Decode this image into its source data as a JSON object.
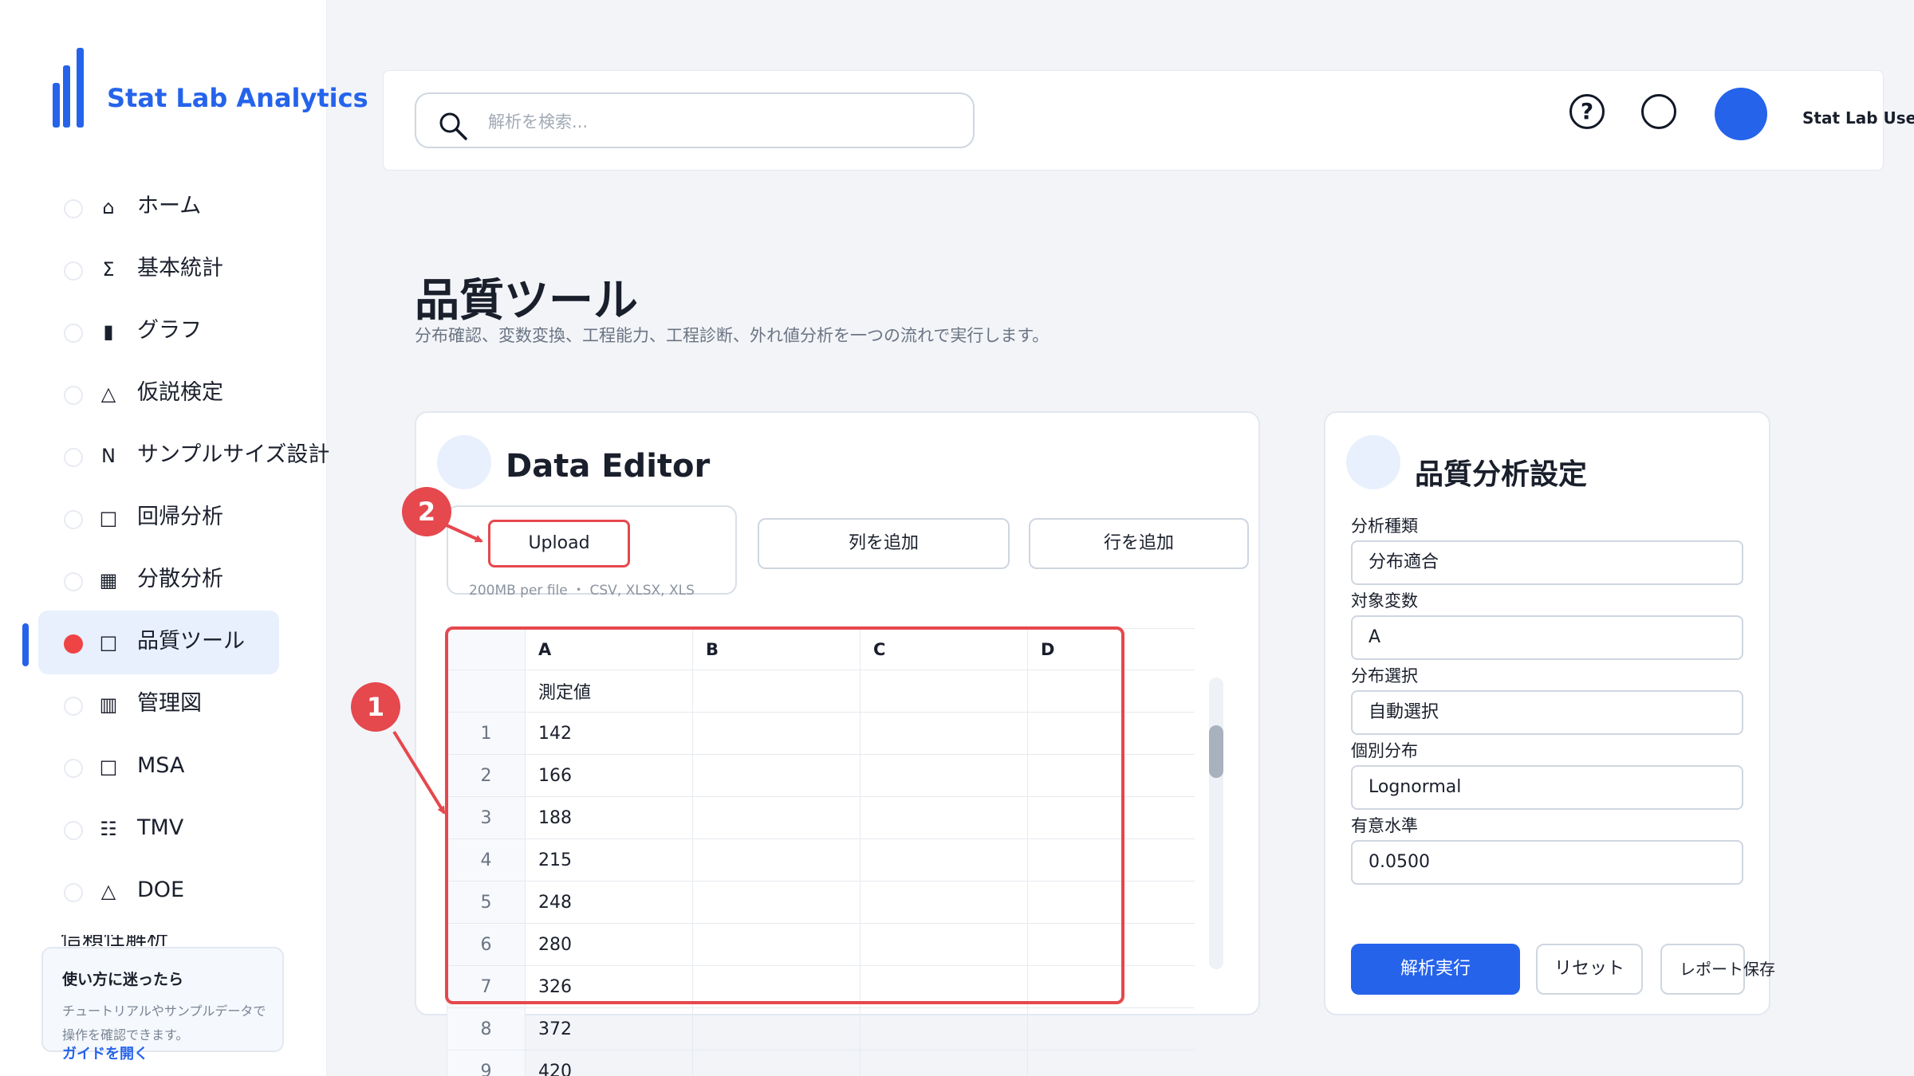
{
  "brand": {
    "name": "Stat Lab Analytics"
  },
  "sidebar": {
    "items": [
      {
        "icon": "⌂",
        "icon_name": "home-icon",
        "label": "ホーム"
      },
      {
        "icon": "Σ",
        "icon_name": "sigma-icon",
        "label": "基本統計"
      },
      {
        "icon": "▮",
        "icon_name": "bar-chart-icon",
        "label": "グラフ"
      },
      {
        "icon": "△",
        "icon_name": "triangle-icon",
        "label": "仮説検定"
      },
      {
        "icon": "N",
        "icon_name": "n-icon",
        "label": "サンプルサイズ設計"
      },
      {
        "icon": "□",
        "icon_name": "regression-icon",
        "label": "回帰分析"
      },
      {
        "icon": "▦",
        "icon_name": "grid-icon",
        "label": "分散分析"
      },
      {
        "icon": "□",
        "icon_name": "quality-icon",
        "label": "品質ツール",
        "active": true
      },
      {
        "icon": "▥",
        "icon_name": "control-chart-icon",
        "label": "管理図"
      },
      {
        "icon": "□",
        "icon_name": "msa-icon",
        "label": "MSA"
      },
      {
        "icon": "☷",
        "icon_name": "tmv-icon",
        "label": "TMV"
      },
      {
        "icon": "△",
        "icon_name": "doe-icon",
        "label": "DOE"
      }
    ],
    "hidden_item_label": "信頼性解析",
    "help": {
      "title": "使い方に迷ったら",
      "description": "チュートリアルやサンプルデータで操作を確認できます。",
      "link": "ガイドを開く"
    }
  },
  "header": {
    "search_placeholder": "解析を検索...",
    "help_icon_glyph": "?",
    "user_name": "Stat Lab User"
  },
  "page": {
    "title": "品質ツール",
    "subtitle": "分布確認、変数変換、工程能力、工程診断、外れ値分析を一つの流れで実行します。"
  },
  "data_editor": {
    "title": "Data Editor",
    "upload_label": "Upload",
    "upload_note": "200MB per file ・ CSV, XLSX, XLS",
    "add_column_label": "列を追加",
    "add_row_label": "行を追加",
    "columns": [
      "A",
      "B",
      "C",
      "D"
    ],
    "rows": [
      {
        "index": "",
        "cells": [
          "測定値",
          "",
          "",
          ""
        ]
      },
      {
        "index": "1",
        "cells": [
          "142",
          "",
          "",
          ""
        ]
      },
      {
        "index": "2",
        "cells": [
          "166",
          "",
          "",
          ""
        ]
      },
      {
        "index": "3",
        "cells": [
          "188",
          "",
          "",
          ""
        ]
      },
      {
        "index": "4",
        "cells": [
          "215",
          "",
          "",
          ""
        ]
      },
      {
        "index": "5",
        "cells": [
          "248",
          "",
          "",
          ""
        ]
      },
      {
        "index": "6",
        "cells": [
          "280",
          "",
          "",
          ""
        ]
      },
      {
        "index": "7",
        "cells": [
          "326",
          "",
          "",
          ""
        ]
      },
      {
        "index": "8",
        "cells": [
          "372",
          "",
          "",
          ""
        ]
      },
      {
        "index": "9",
        "cells": [
          "420",
          "",
          "",
          ""
        ]
      }
    ]
  },
  "settings": {
    "title": "品質分析設定",
    "fields": [
      {
        "label": "分析種類",
        "value": "分布適合"
      },
      {
        "label": "対象変数",
        "value": "A"
      },
      {
        "label": "分布選択",
        "value": "自動選択"
      },
      {
        "label": "個別分布",
        "value": "Lognormal"
      },
      {
        "label": "有意水準",
        "value": "0.0500"
      }
    ],
    "run_label": "解析実行",
    "reset_label": "リセット",
    "save_label": "レポート保存"
  },
  "annotations": {
    "badge_1": "1",
    "badge_2": "2"
  },
  "colors": {
    "accent": "#2563eb",
    "highlight": "#e5484d",
    "background": "#f2f4f8"
  }
}
